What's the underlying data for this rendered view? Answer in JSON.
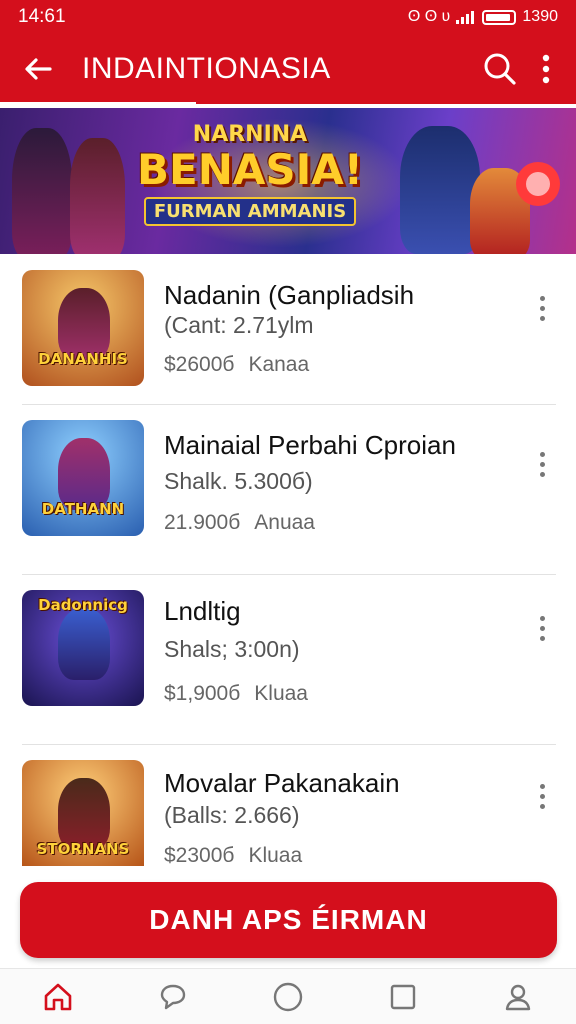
{
  "status_bar": {
    "time": "14:61",
    "icons_text": "ʘ ʘ ʋ",
    "battery_text": "1390"
  },
  "app_bar": {
    "title": "INDAINTIONASIA",
    "back_icon": "arrow-left-icon",
    "search_icon": "search-icon",
    "more_icon": "more-vert-icon"
  },
  "banner": {
    "top_text": "NARNINA",
    "main_text": "BENASIA!",
    "sub_text": "FURMAN AMMANIS"
  },
  "items": [
    {
      "title": "Nadanin (Ganpliadsih",
      "subtitle": "(Cant: 2.71ylm",
      "price": "$2600б",
      "tag": "Kanaa",
      "thumb_label": "DANANHIS",
      "thumb_bg": "#e8a23a"
    },
    {
      "title": "Mainaial Perbahi Cproian",
      "subtitle": "Shalk. 5.300б)",
      "price": "21.900б",
      "tag": "Anuaa",
      "thumb_label": "DATHANN",
      "thumb_bg": "#3a8fd8"
    },
    {
      "title": "Lndltig",
      "subtitle": "Shals; 3:00n)",
      "price": "$1,900б",
      "tag": "Kluaa",
      "thumb_label": "Dadonnicg",
      "thumb_bg": "#2a1f6a"
    },
    {
      "title": "Movalar Pakanakain",
      "subtitle": "(Balls: 2.666)",
      "price": "$2300б",
      "tag": "Kluaa",
      "thumb_label": "STORNANS",
      "thumb_bg": "#d8741e"
    }
  ],
  "cta": {
    "label": "DANH APS ÉIRMAN"
  },
  "bottom_nav": [
    {
      "icon": "home-icon"
    },
    {
      "icon": "chat-icon"
    },
    {
      "icon": "circle-icon"
    },
    {
      "icon": "square-icon"
    },
    {
      "icon": "profile-icon"
    }
  ],
  "colors": {
    "brand": "#d40f1c"
  }
}
